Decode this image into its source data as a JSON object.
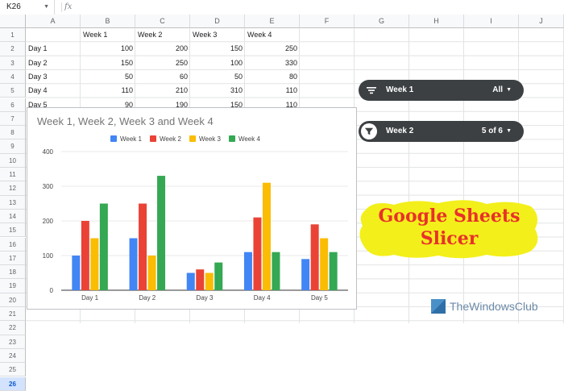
{
  "formula_bar": {
    "name_box": "K26",
    "fx": "fx"
  },
  "columns": [
    "A",
    "B",
    "C",
    "D",
    "E",
    "F",
    "G",
    "H",
    "I",
    "J"
  ],
  "rows": [
    "1",
    "2",
    "3",
    "4",
    "5",
    "6",
    "7",
    "8",
    "9",
    "10",
    "11",
    "12",
    "13",
    "14",
    "15",
    "16",
    "17",
    "18",
    "19",
    "20",
    "21",
    "22",
    "23",
    "24",
    "25",
    "26"
  ],
  "selected_row": "26",
  "table": {
    "headers": [
      "Week 1",
      "Week 2",
      "Week 3",
      "Week 4"
    ],
    "rows": [
      {
        "label": "Day 1",
        "values": [
          "100",
          "200",
          "150",
          "250"
        ]
      },
      {
        "label": "Day 2",
        "values": [
          "150",
          "250",
          "100",
          "330"
        ]
      },
      {
        "label": "Day 3",
        "values": [
          "50",
          "60",
          "50",
          "80"
        ]
      },
      {
        "label": "Day 4",
        "values": [
          "110",
          "210",
          "310",
          "110"
        ]
      },
      {
        "label": "Day 5",
        "values": [
          "90",
          "190",
          "150",
          "110"
        ]
      }
    ]
  },
  "slicers": [
    {
      "label": "Week 1",
      "value": "All",
      "caret": "▼",
      "icon": "filter-lines-icon"
    },
    {
      "label": "Week 2",
      "value": "5 of 6",
      "caret": "▼",
      "icon": "funnel-icon"
    }
  ],
  "promo": {
    "line1": "Google Sheets",
    "line2": "Slicer",
    "text_color": "#e8312a",
    "blob_color": "#f3ef1a"
  },
  "watermark": {
    "text": "TheWindowsClub",
    "color": "#6b8aa8"
  },
  "chart_data": {
    "type": "bar",
    "title": "Week 1, Week 2, Week 3 and Week 4",
    "categories": [
      "Day 1",
      "Day 2",
      "Day 3",
      "Day 4",
      "Day 5"
    ],
    "series": [
      {
        "name": "Week 1",
        "values": [
          100,
          150,
          50,
          110,
          90
        ],
        "color": "#4285f4"
      },
      {
        "name": "Week 2",
        "values": [
          200,
          250,
          60,
          210,
          190
        ],
        "color": "#ea4335"
      },
      {
        "name": "Week 3",
        "values": [
          150,
          100,
          50,
          310,
          150
        ],
        "color": "#fbbc04"
      },
      {
        "name": "Week 4",
        "values": [
          250,
          330,
          80,
          110,
          110
        ],
        "color": "#34a853"
      }
    ],
    "ylim": [
      0,
      400
    ],
    "yticks": [
      "0",
      "100",
      "200",
      "300",
      "400"
    ],
    "grid": true,
    "legend_position": "top"
  }
}
